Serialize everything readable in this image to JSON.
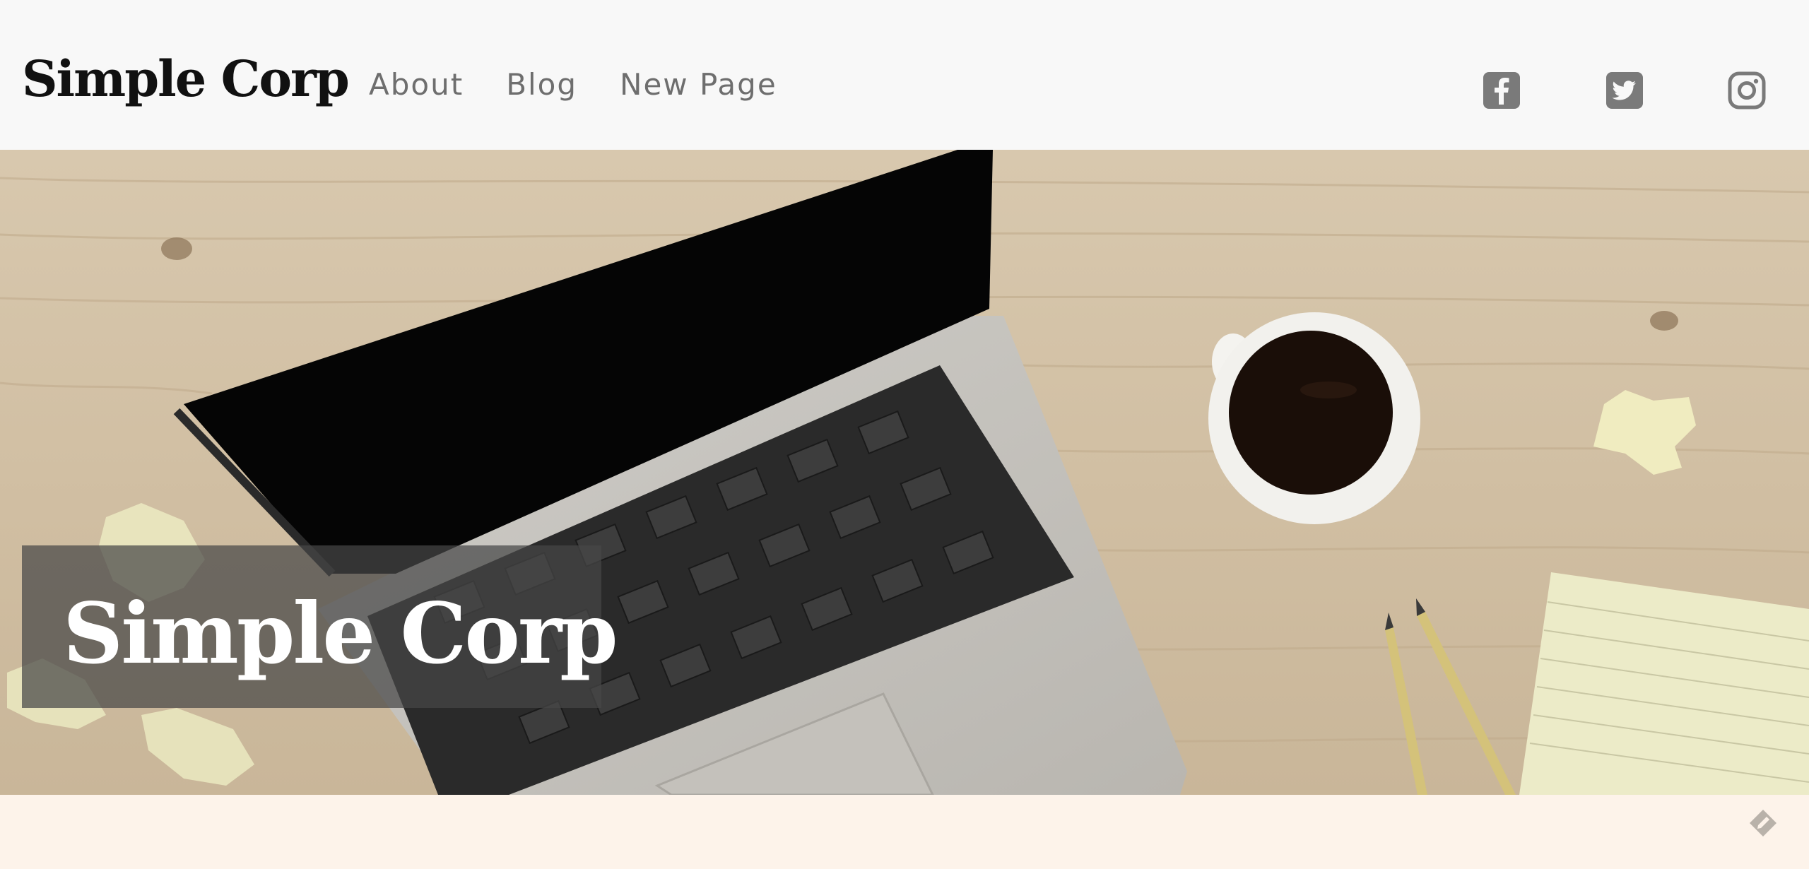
{
  "header": {
    "brand": "Simple Corp",
    "nav": [
      {
        "label": "About"
      },
      {
        "label": "Blog"
      },
      {
        "label": "New Page"
      }
    ],
    "social": [
      {
        "icon": "facebook-icon"
      },
      {
        "icon": "twitter-icon"
      },
      {
        "icon": "instagram-icon"
      }
    ]
  },
  "hero": {
    "title": "Simple Corp"
  },
  "colors": {
    "header_bg": "#f8f8f8",
    "brand_text": "#111111",
    "nav_text": "#6e6e6e",
    "icon_gray": "#777777",
    "caption_bg": "#464646",
    "strip_bg": "#fdf3ea"
  }
}
